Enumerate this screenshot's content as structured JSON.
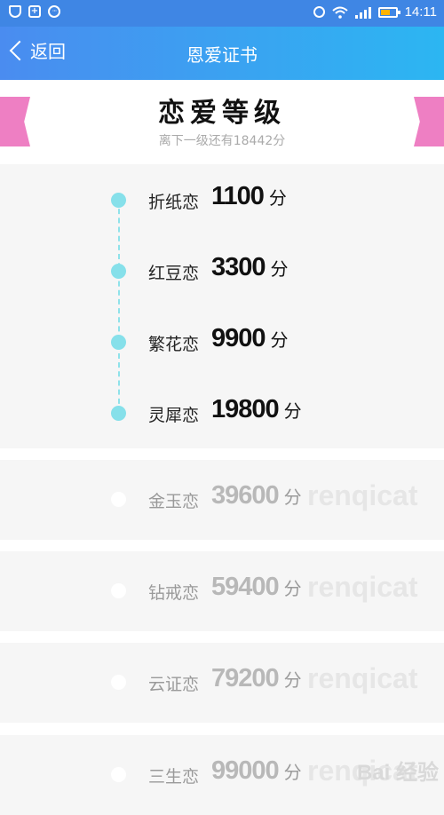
{
  "status_bar": {
    "time": "14:11"
  },
  "app_bar": {
    "back_label": "返回",
    "title": "恩爱证书"
  },
  "header": {
    "title": "恋爱等级",
    "subtitle": "离下一级还有18442分"
  },
  "unit": "分",
  "levels_unlocked": [
    {
      "name": "折纸恋",
      "score": "1100"
    },
    {
      "name": "红豆恋",
      "score": "3300"
    },
    {
      "name": "繁花恋",
      "score": "9900"
    },
    {
      "name": "灵犀恋",
      "score": "19800"
    }
  ],
  "levels_locked": [
    {
      "name": "金玉恋",
      "score": "39600",
      "watermark": "renqicat"
    },
    {
      "name": "钻戒恋",
      "score": "59400",
      "watermark": "renqicat"
    },
    {
      "name": "云证恋",
      "score": "79200",
      "watermark": "renqicat"
    },
    {
      "name": "三生恋",
      "score": "99000",
      "watermark": "renqicat"
    }
  ],
  "baidu_watermark": "Bai 经验",
  "colors": {
    "appbar_start": "#4a8cf0",
    "appbar_end": "#2cb6f2",
    "dot": "#86e0ea",
    "ribbon": "#ee7fc3"
  }
}
